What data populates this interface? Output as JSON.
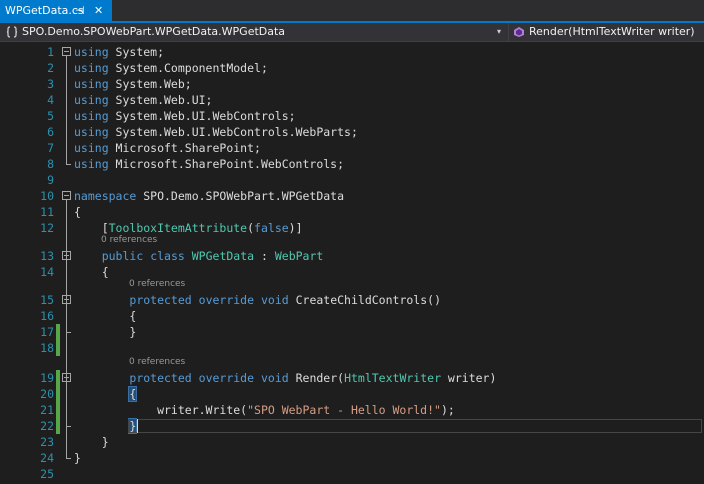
{
  "tab": {
    "title": "WPGetData.cs",
    "pin_glyph": "⊣",
    "close_glyph": "✕"
  },
  "nav": {
    "type_path": "SPO.Demo.SPOWebPart.WPGetData.WPGetData",
    "member": "Render(HtmlTextWriter writer)",
    "dropdown_glyph": "▾"
  },
  "codelens_text": "0 references",
  "lines": [
    {
      "n": "1",
      "tokens": [
        [
          "kw",
          "using"
        ],
        [
          "tx",
          " System;"
        ]
      ]
    },
    {
      "n": "2",
      "tokens": [
        [
          "kw",
          "using"
        ],
        [
          "tx",
          " System.ComponentModel;"
        ]
      ]
    },
    {
      "n": "3",
      "tokens": [
        [
          "kw",
          "using"
        ],
        [
          "tx",
          " System.Web;"
        ]
      ]
    },
    {
      "n": "4",
      "tokens": [
        [
          "kw",
          "using"
        ],
        [
          "tx",
          " System.Web.UI;"
        ]
      ]
    },
    {
      "n": "5",
      "tokens": [
        [
          "kw",
          "using"
        ],
        [
          "tx",
          " System.Web.UI.WebControls;"
        ]
      ]
    },
    {
      "n": "6",
      "tokens": [
        [
          "kw",
          "using"
        ],
        [
          "tx",
          " System.Web.UI.WebControls.WebParts;"
        ]
      ]
    },
    {
      "n": "7",
      "tokens": [
        [
          "kw",
          "using"
        ],
        [
          "tx",
          " Microsoft.SharePoint;"
        ]
      ]
    },
    {
      "n": "8",
      "tokens": [
        [
          "kw",
          "using"
        ],
        [
          "tx",
          " Microsoft.SharePoint.WebControls;"
        ]
      ]
    },
    {
      "n": "9",
      "tokens": []
    },
    {
      "n": "10",
      "tokens": [
        [
          "kw",
          "namespace"
        ],
        [
          "tx",
          " SPO.Demo.SPOWebPart.WPGetData"
        ]
      ]
    },
    {
      "n": "11",
      "tokens": [
        [
          "tx",
          "{"
        ]
      ]
    },
    {
      "n": "12",
      "tokens": [
        [
          "tx",
          "    ["
        ],
        [
          "ty",
          "ToolboxItemAttribute"
        ],
        [
          "tx",
          "("
        ],
        [
          "kw",
          "false"
        ],
        [
          "tx",
          ")]"
        ]
      ]
    },
    {
      "n": "13",
      "tokens": [
        [
          "tx",
          "    "
        ],
        [
          "kw",
          "public"
        ],
        [
          "tx",
          " "
        ],
        [
          "kw",
          "class"
        ],
        [
          "tx",
          " "
        ],
        [
          "ty",
          "WPGetData"
        ],
        [
          "tx",
          " : "
        ],
        [
          "ty",
          "WebPart"
        ]
      ]
    },
    {
      "n": "14",
      "tokens": [
        [
          "tx",
          "    {"
        ]
      ]
    },
    {
      "n": "15",
      "tokens": [
        [
          "tx",
          "        "
        ],
        [
          "kw",
          "protected"
        ],
        [
          "tx",
          " "
        ],
        [
          "kw",
          "override"
        ],
        [
          "tx",
          " "
        ],
        [
          "kw",
          "void"
        ],
        [
          "tx",
          " CreateChildControls()"
        ]
      ]
    },
    {
      "n": "16",
      "tokens": [
        [
          "tx",
          "        {"
        ]
      ]
    },
    {
      "n": "17",
      "tokens": [
        [
          "tx",
          "        }"
        ]
      ]
    },
    {
      "n": "18",
      "tokens": []
    },
    {
      "n": "19",
      "tokens": [
        [
          "tx",
          "        "
        ],
        [
          "kw",
          "protected"
        ],
        [
          "tx",
          " "
        ],
        [
          "kw",
          "override"
        ],
        [
          "tx",
          " "
        ],
        [
          "kw",
          "void"
        ],
        [
          "tx",
          " Render("
        ],
        [
          "ty",
          "HtmlTextWriter"
        ],
        [
          "tx",
          " writer)"
        ]
      ]
    },
    {
      "n": "20",
      "tokens": [
        [
          "tx",
          "        "
        ],
        [
          "hl",
          "{"
        ]
      ]
    },
    {
      "n": "21",
      "tokens": [
        [
          "tx",
          "            writer.Write("
        ],
        [
          "st",
          "\"SPO WebPart - Hello World!\""
        ],
        [
          "tx",
          ");"
        ]
      ]
    },
    {
      "n": "22",
      "tokens": [
        [
          "tx",
          "        "
        ],
        [
          "hl",
          "}"
        ]
      ]
    },
    {
      "n": "23",
      "tokens": [
        [
          "tx",
          "    }"
        ]
      ]
    },
    {
      "n": "24",
      "tokens": [
        [
          "tx",
          "}"
        ]
      ]
    },
    {
      "n": "25",
      "tokens": []
    }
  ],
  "colors": {
    "accent": "#007acc",
    "keyword": "#569cd6",
    "type": "#4ec9b0",
    "string": "#d69d85",
    "line_number": "#2b91af",
    "change_marker": "#57a64a"
  },
  "icons": {
    "namespace_icon": "namespace-icon",
    "method_icon": "method-icon"
  }
}
